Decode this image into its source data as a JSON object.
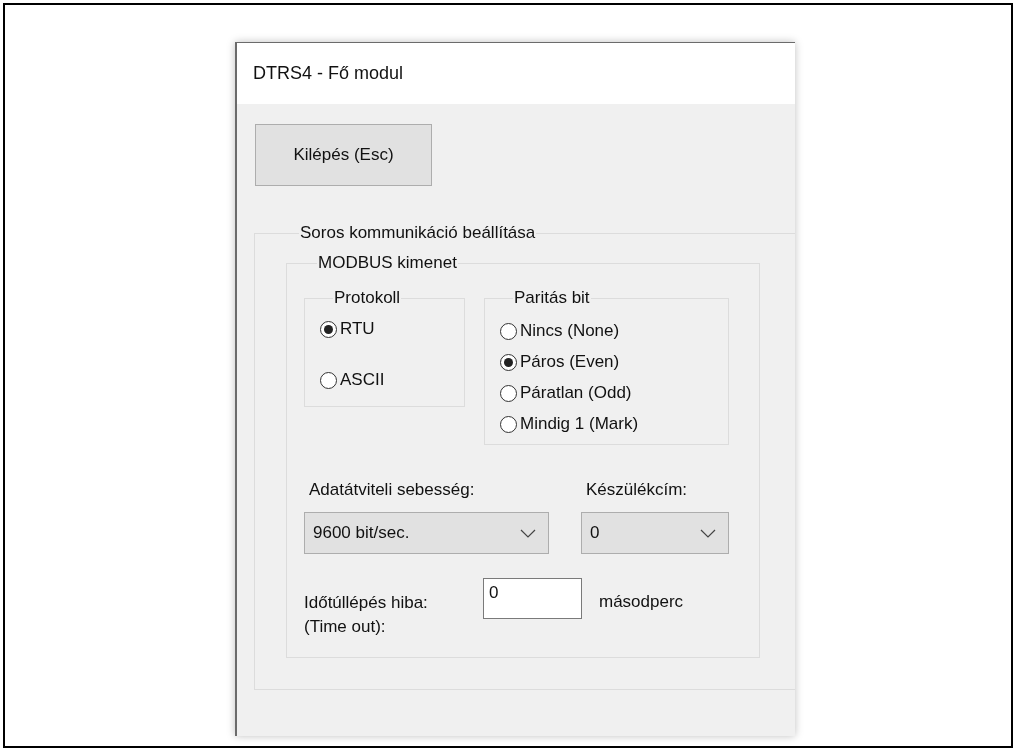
{
  "window": {
    "title": "DTRS4 - Fő modul"
  },
  "exit_button": {
    "label": "Kilépés (Esc)"
  },
  "serial_group": {
    "title": "Soros kommunikáció beállítása",
    "modbus_group": {
      "title": "MODBUS kimenet",
      "protocol": {
        "title": "Protokoll",
        "options": [
          {
            "label": "RTU",
            "selected": true
          },
          {
            "label": "ASCII",
            "selected": false
          }
        ]
      },
      "parity": {
        "title": "Paritás bit",
        "options": [
          {
            "label": "Nincs (None)",
            "selected": false
          },
          {
            "label": "Páros (Even)",
            "selected": true
          },
          {
            "label": "Páratlan (Odd)",
            "selected": false
          },
          {
            "label": "Mindig 1 (Mark)",
            "selected": false
          }
        ]
      },
      "baud_rate": {
        "label": "Adatátviteli sebesség:",
        "value": "9600 bit/sec."
      },
      "device_address": {
        "label": "Készülékcím:",
        "value": "0"
      },
      "timeout": {
        "label": "Időtúllépés hiba: (Time out):",
        "value": "0",
        "unit": "másodperc"
      }
    }
  }
}
